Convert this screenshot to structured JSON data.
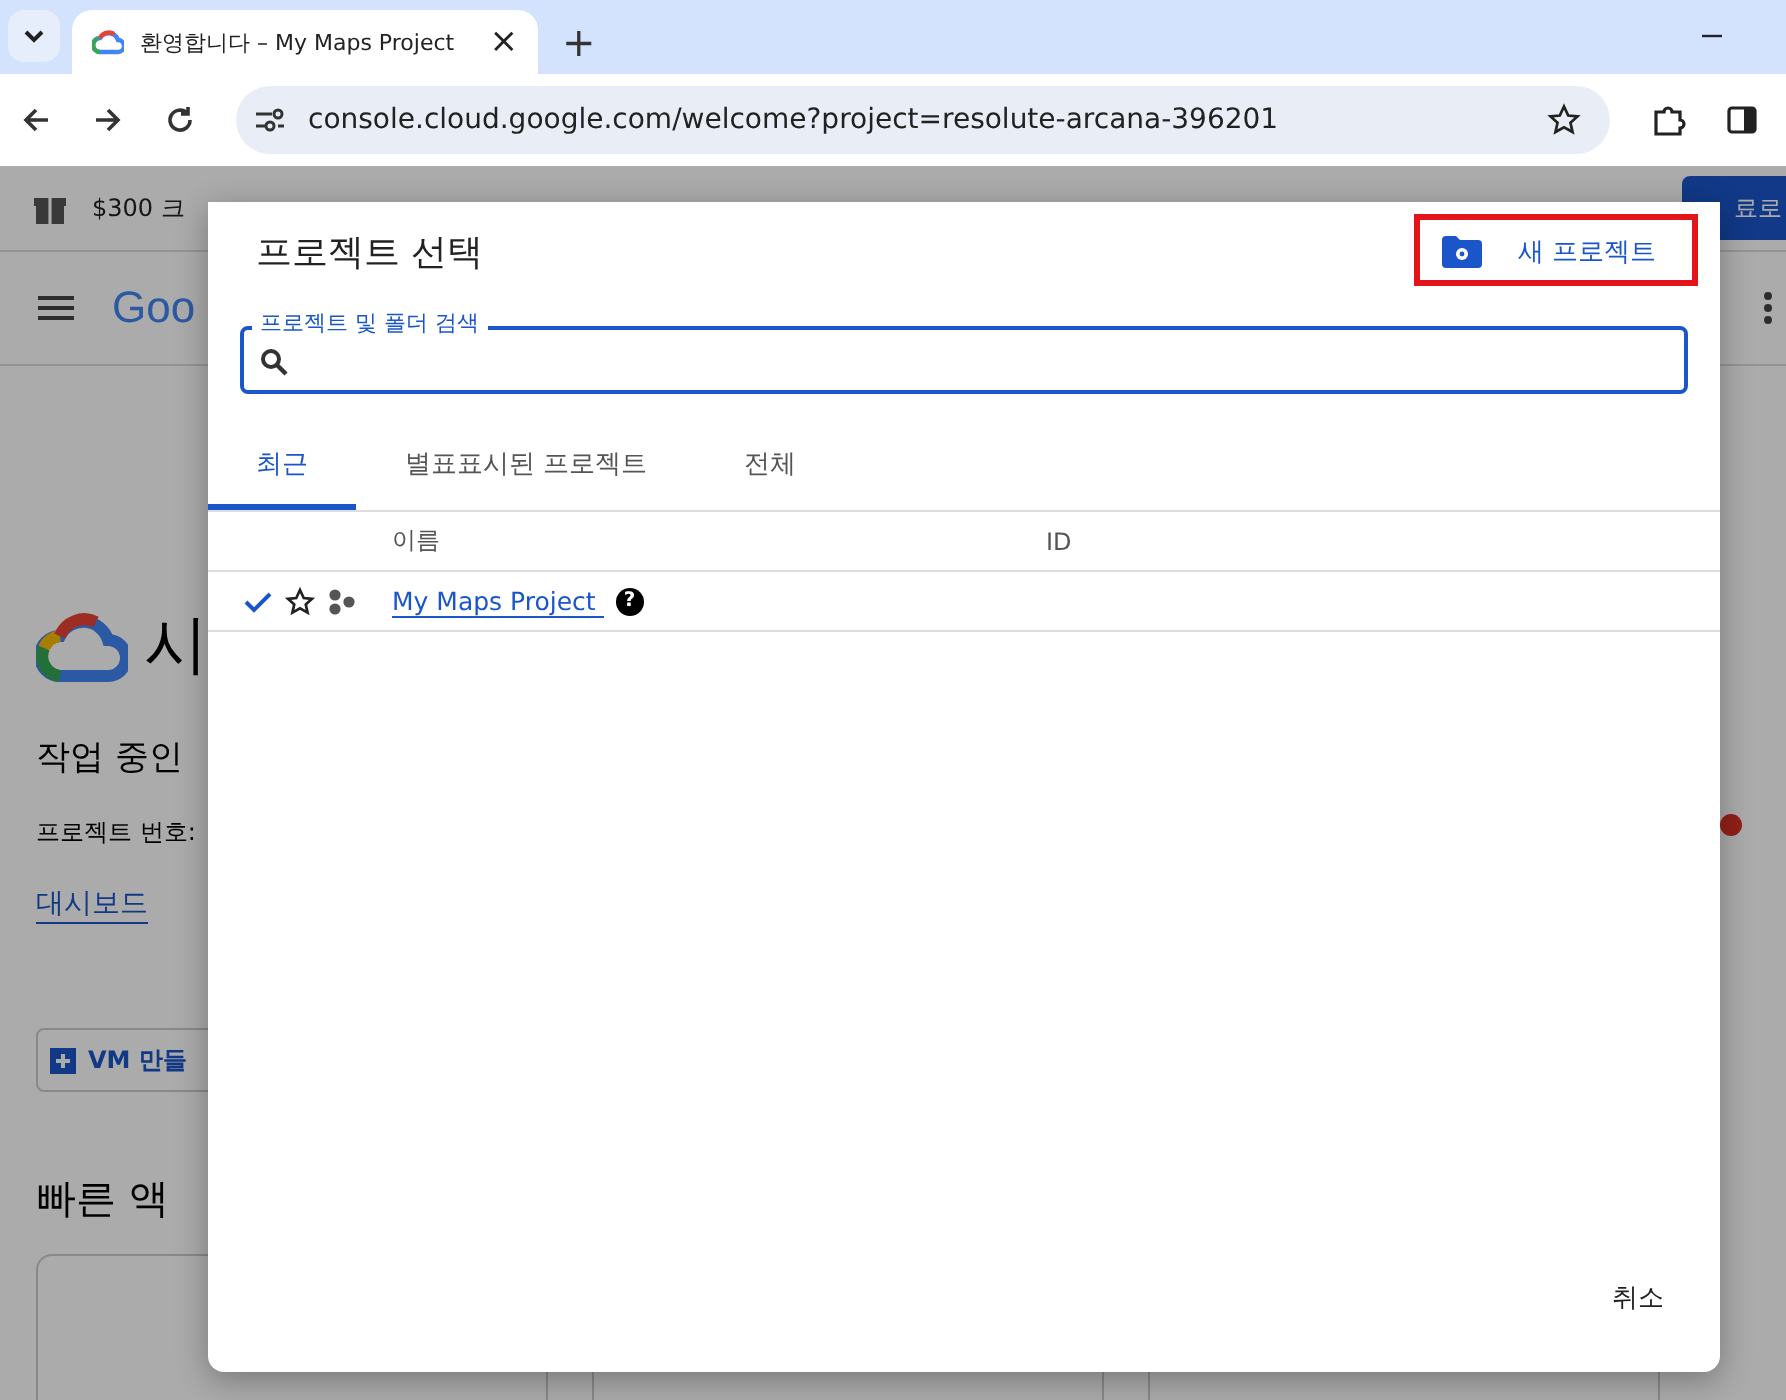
{
  "browser": {
    "tab_title": "환영합니다 – My Maps Project",
    "tab_close": "×",
    "new_tab": "+",
    "url": "console.cloud.google.com/welcome?project=resolute-arcana-396201"
  },
  "background_page": {
    "promo": "$300 크",
    "promo_button": "료로",
    "logo": "Goo",
    "heading": "시",
    "subheading": "작업 중인",
    "project_number_label": "프로젝트 번호:",
    "links": [
      "대시보드"
    ],
    "vm_button": "VM 만들",
    "quick_access": "빠른 액"
  },
  "dialog": {
    "title": "프로젝트 선택",
    "new_project": "새 프로젝트",
    "search": {
      "label": "프로젝트 및 폴더 검색"
    },
    "tabs": [
      {
        "label": "최근",
        "selected": true
      },
      {
        "label": "별표표시된 프로젝트",
        "selected": false
      },
      {
        "label": "전체",
        "selected": false
      }
    ],
    "columns": [
      "이름",
      "ID"
    ],
    "rows": [
      {
        "name": "My Maps Project",
        "current": true,
        "starred": false,
        "help": "?"
      }
    ],
    "cancel": "취소"
  }
}
